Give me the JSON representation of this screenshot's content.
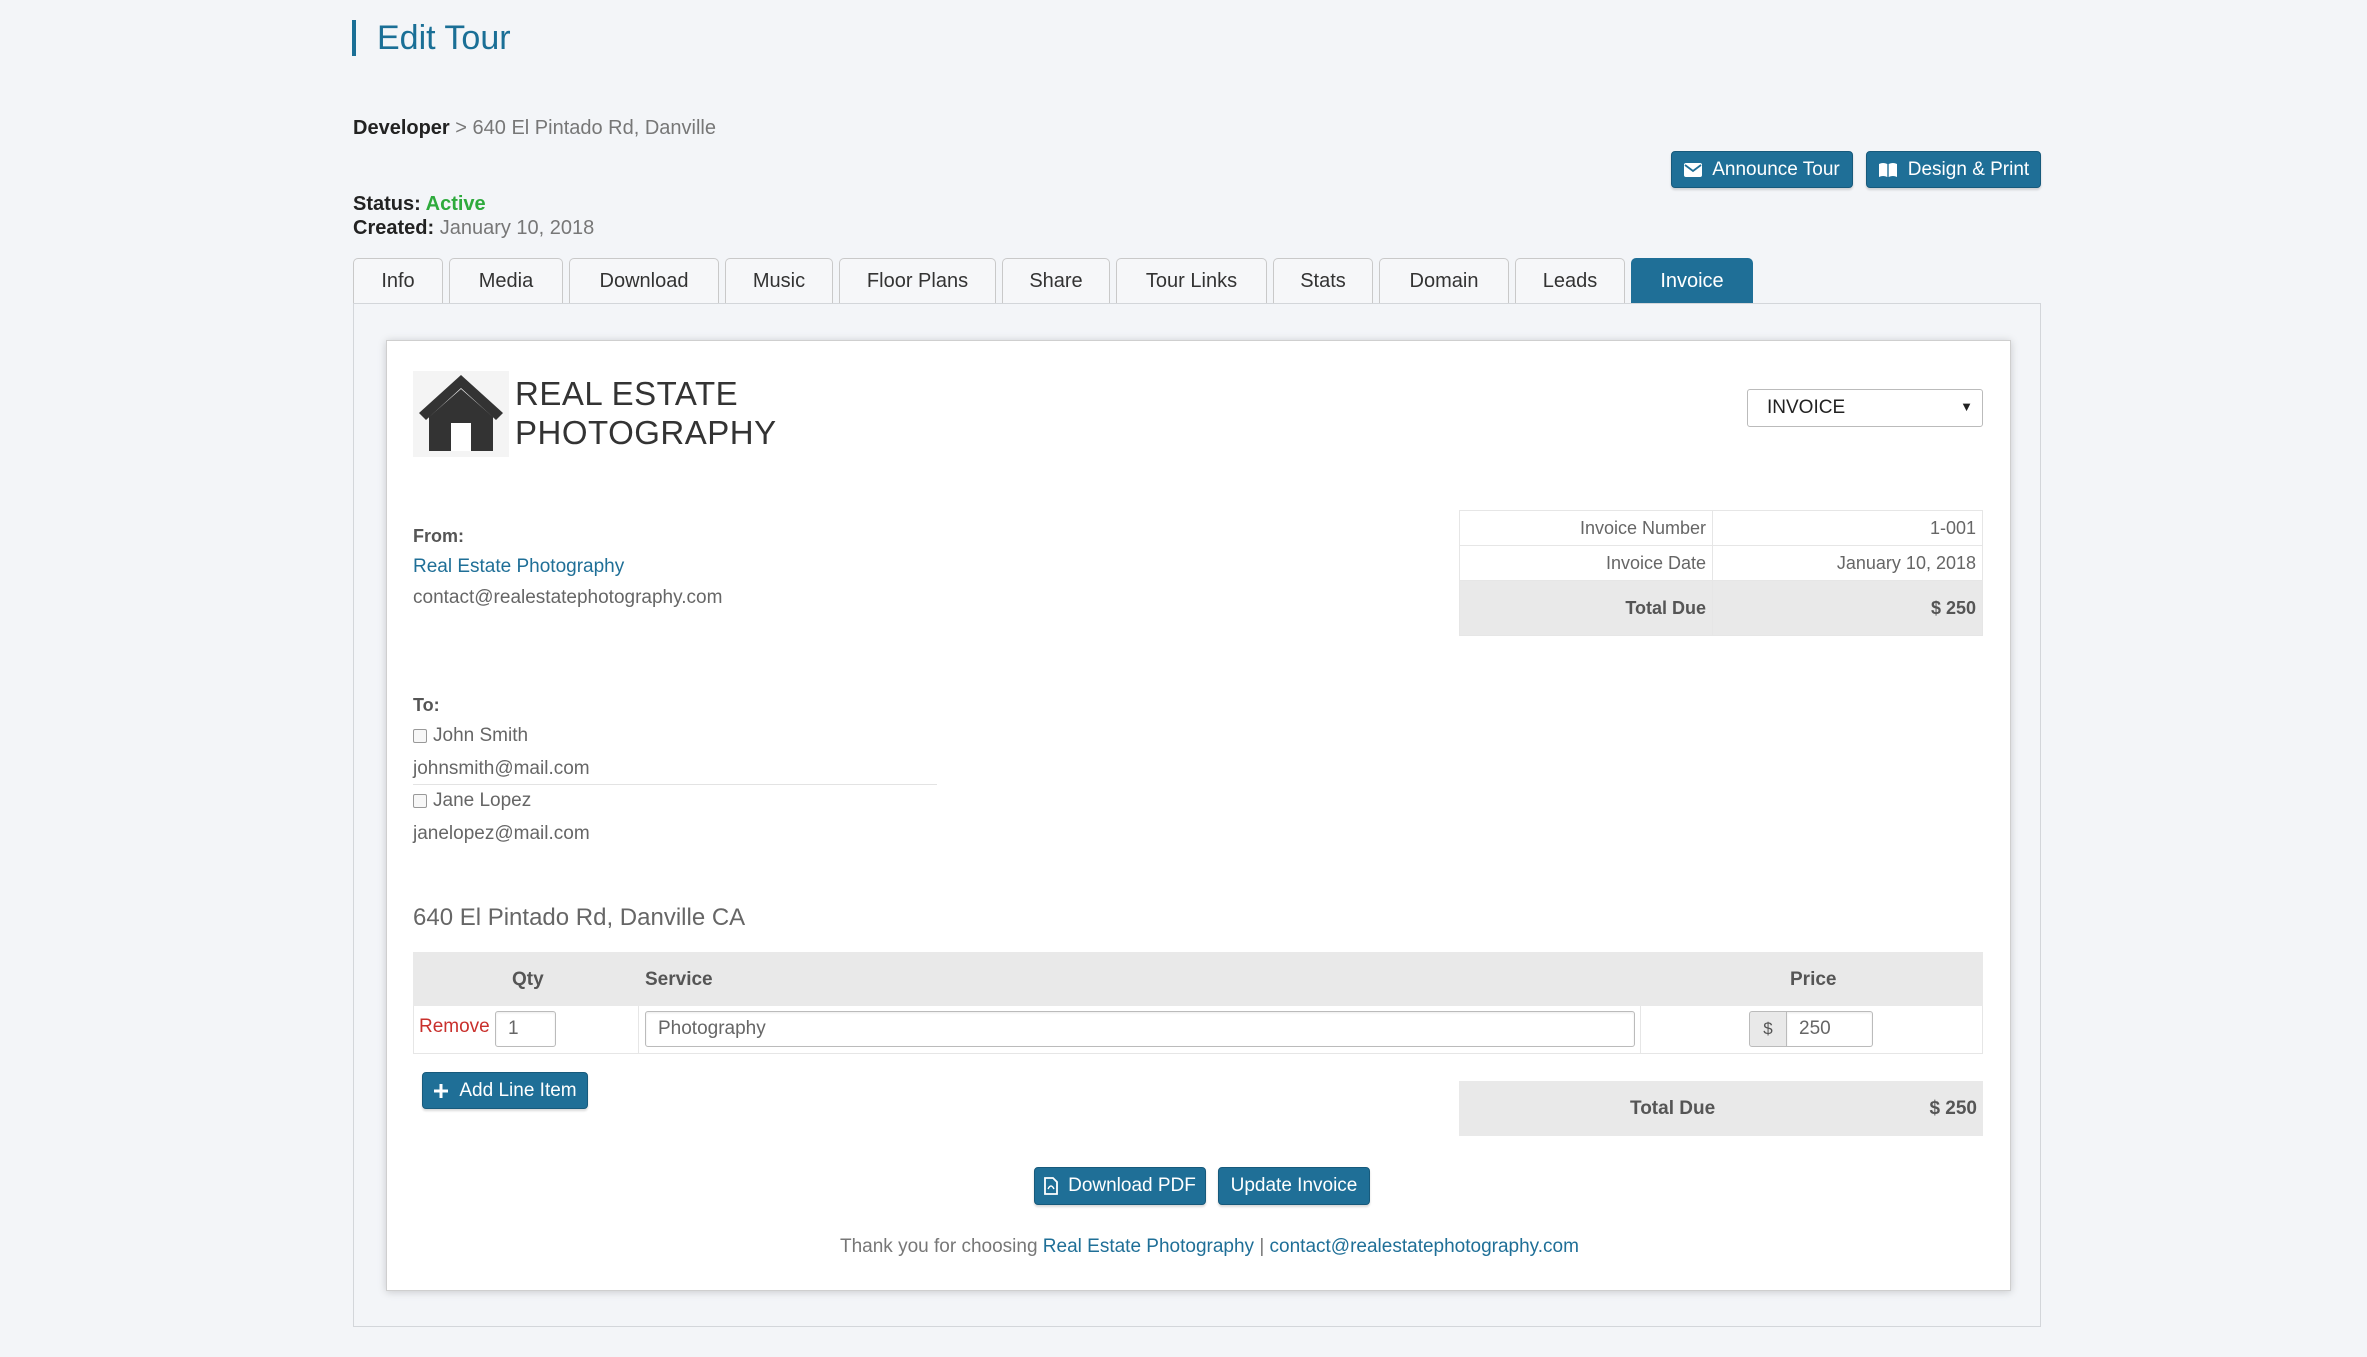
{
  "header": {
    "title": "Edit Tour",
    "breadcrumb_root": "Developer",
    "breadcrumb_sep": " > ",
    "breadcrumb_current": "640 El Pintado Rd,  Danville",
    "status_label": "Status:",
    "status_value": "Active",
    "created_label": "Created:",
    "created_value": "January 10, 2018",
    "announce_label": "Announce Tour",
    "design_label": "Design & Print"
  },
  "tabs": [
    {
      "label": "Info",
      "active": false
    },
    {
      "label": "Media",
      "active": false
    },
    {
      "label": "Download",
      "active": false
    },
    {
      "label": "Music",
      "active": false
    },
    {
      "label": "Floor Plans",
      "active": false
    },
    {
      "label": "Share",
      "active": false
    },
    {
      "label": "Tour Links",
      "active": false
    },
    {
      "label": "Stats",
      "active": false
    },
    {
      "label": "Domain",
      "active": false
    },
    {
      "label": "Leads",
      "active": false
    },
    {
      "label": "Invoice",
      "active": true
    }
  ],
  "invoice": {
    "logo_line1": "REAL ESTATE",
    "logo_line2": "PHOTOGRAPHY",
    "doc_type": "INVOICE",
    "from_label": "From:",
    "from_name": "Real Estate Photography",
    "from_email": "contact@realestatephotography.com",
    "meta": {
      "number_label": "Invoice Number",
      "number_value": "1-001",
      "date_label": "Invoice Date",
      "date_value": "January 10, 2018",
      "total_label": "Total Due",
      "total_value": "$ 250"
    },
    "to_label": "To:",
    "recipients": [
      {
        "name": "John Smith",
        "email": "johnsmith@mail.com",
        "checked": false
      },
      {
        "name": "Jane Lopez",
        "email": "janelopez@mail.com",
        "checked": false
      }
    ],
    "address": "640 El Pintado Rd, Danville CA",
    "columns": {
      "qty": "Qty",
      "service": "Service",
      "price": "Price"
    },
    "line_items": [
      {
        "remove_label": "Remove",
        "qty": "1",
        "service": "Photography",
        "currency": "$",
        "price": "250"
      }
    ],
    "add_line_label": "Add Line Item",
    "total_label": "Total Due",
    "total_value": "$ 250",
    "download_pdf_label": "Download PDF",
    "update_label": "Update Invoice",
    "footer_prefix": "Thank you for choosing ",
    "footer_name": "Real Estate Photography",
    "footer_sep": " | ",
    "footer_email": "contact@realestatephotography.com"
  },
  "colors": {
    "primary": "#1f6f97",
    "active_status": "#2eaa3c",
    "remove": "#c9302c"
  },
  "icons": {
    "announce": "envelope-icon",
    "design": "book-icon",
    "add": "plus-icon",
    "pdf": "file-pdf-icon",
    "logo": "house-icon"
  }
}
